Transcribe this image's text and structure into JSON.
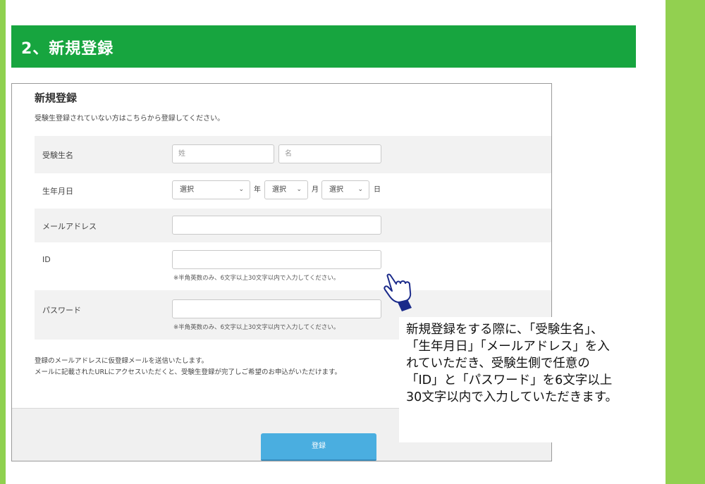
{
  "header": {
    "title": "2、新規登録"
  },
  "form": {
    "title": "新規登録",
    "description": "受験生登録されていない方はこちらから登録してください。",
    "name": {
      "label": "受験生名",
      "last_placeholder": "姓",
      "first_placeholder": "名"
    },
    "birthdate": {
      "label": "生年月日",
      "year_value": "選択",
      "year_unit": "年",
      "month_value": "選択",
      "month_unit": "月",
      "day_value": "選択",
      "day_unit": "日"
    },
    "email": {
      "label": "メールアドレス"
    },
    "id": {
      "label": "ID",
      "hint": "※半角英数のみ、6文字以上30文字以内で入力してください。"
    },
    "password": {
      "label": "パスワード",
      "hint": "※半角英数のみ、6文字以上30文字以内で入力してください。"
    },
    "notes": [
      "登録のメールアドレスに仮登録メールを送信いたします。",
      "メールに記載されたURLにアクセスいただくと、受験生登録が完了しご希望のお申込がいただけます。"
    ],
    "submit_label": "登録"
  },
  "callout": {
    "text": "新規登録をする際に、「受験生名」、「生年月日」「メールアドレス」を入れていただき、受験生側で任意の「ID」と「パスワード」を6文字以上30文字以内で入力していただきます。"
  },
  "icons": {
    "pointer": "pointing-hand-icon",
    "chevron": "chevron-down-icon"
  },
  "colors": {
    "header_green": "#17a53f",
    "side_green": "#92d050",
    "button_blue": "#4aaee0"
  }
}
